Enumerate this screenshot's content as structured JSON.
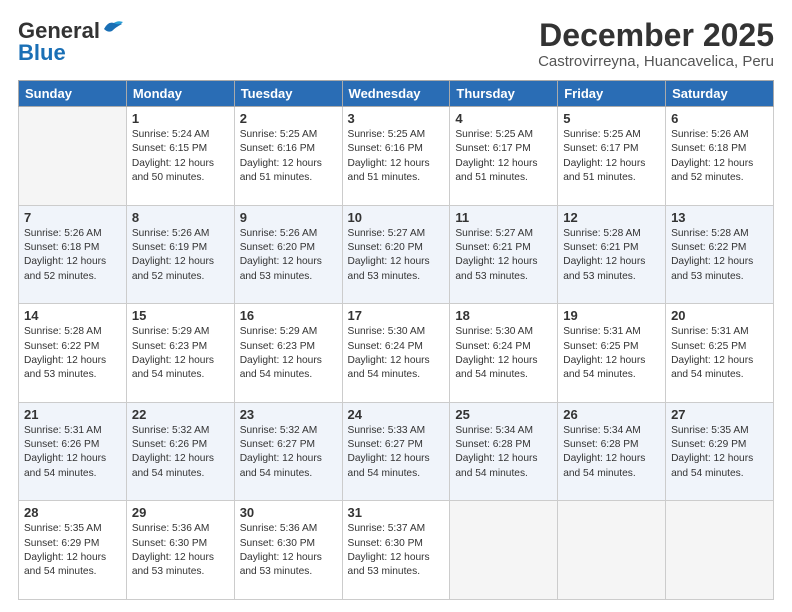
{
  "header": {
    "logo_general": "General",
    "logo_blue": "Blue",
    "month_title": "December 2025",
    "location": "Castrovirreyna, Huancavelica, Peru"
  },
  "days_header": [
    "Sunday",
    "Monday",
    "Tuesday",
    "Wednesday",
    "Thursday",
    "Friday",
    "Saturday"
  ],
  "weeks": [
    [
      {
        "day": "",
        "text": ""
      },
      {
        "day": "1",
        "text": "Sunrise: 5:24 AM\nSunset: 6:15 PM\nDaylight: 12 hours\nand 50 minutes."
      },
      {
        "day": "2",
        "text": "Sunrise: 5:25 AM\nSunset: 6:16 PM\nDaylight: 12 hours\nand 51 minutes."
      },
      {
        "day": "3",
        "text": "Sunrise: 5:25 AM\nSunset: 6:16 PM\nDaylight: 12 hours\nand 51 minutes."
      },
      {
        "day": "4",
        "text": "Sunrise: 5:25 AM\nSunset: 6:17 PM\nDaylight: 12 hours\nand 51 minutes."
      },
      {
        "day": "5",
        "text": "Sunrise: 5:25 AM\nSunset: 6:17 PM\nDaylight: 12 hours\nand 51 minutes."
      },
      {
        "day": "6",
        "text": "Sunrise: 5:26 AM\nSunset: 6:18 PM\nDaylight: 12 hours\nand 52 minutes."
      }
    ],
    [
      {
        "day": "7",
        "text": "Sunrise: 5:26 AM\nSunset: 6:18 PM\nDaylight: 12 hours\nand 52 minutes."
      },
      {
        "day": "8",
        "text": "Sunrise: 5:26 AM\nSunset: 6:19 PM\nDaylight: 12 hours\nand 52 minutes."
      },
      {
        "day": "9",
        "text": "Sunrise: 5:26 AM\nSunset: 6:20 PM\nDaylight: 12 hours\nand 53 minutes."
      },
      {
        "day": "10",
        "text": "Sunrise: 5:27 AM\nSunset: 6:20 PM\nDaylight: 12 hours\nand 53 minutes."
      },
      {
        "day": "11",
        "text": "Sunrise: 5:27 AM\nSunset: 6:21 PM\nDaylight: 12 hours\nand 53 minutes."
      },
      {
        "day": "12",
        "text": "Sunrise: 5:28 AM\nSunset: 6:21 PM\nDaylight: 12 hours\nand 53 minutes."
      },
      {
        "day": "13",
        "text": "Sunrise: 5:28 AM\nSunset: 6:22 PM\nDaylight: 12 hours\nand 53 minutes."
      }
    ],
    [
      {
        "day": "14",
        "text": "Sunrise: 5:28 AM\nSunset: 6:22 PM\nDaylight: 12 hours\nand 53 minutes."
      },
      {
        "day": "15",
        "text": "Sunrise: 5:29 AM\nSunset: 6:23 PM\nDaylight: 12 hours\nand 54 minutes."
      },
      {
        "day": "16",
        "text": "Sunrise: 5:29 AM\nSunset: 6:23 PM\nDaylight: 12 hours\nand 54 minutes."
      },
      {
        "day": "17",
        "text": "Sunrise: 5:30 AM\nSunset: 6:24 PM\nDaylight: 12 hours\nand 54 minutes."
      },
      {
        "day": "18",
        "text": "Sunrise: 5:30 AM\nSunset: 6:24 PM\nDaylight: 12 hours\nand 54 minutes."
      },
      {
        "day": "19",
        "text": "Sunrise: 5:31 AM\nSunset: 6:25 PM\nDaylight: 12 hours\nand 54 minutes."
      },
      {
        "day": "20",
        "text": "Sunrise: 5:31 AM\nSunset: 6:25 PM\nDaylight: 12 hours\nand 54 minutes."
      }
    ],
    [
      {
        "day": "21",
        "text": "Sunrise: 5:31 AM\nSunset: 6:26 PM\nDaylight: 12 hours\nand 54 minutes."
      },
      {
        "day": "22",
        "text": "Sunrise: 5:32 AM\nSunset: 6:26 PM\nDaylight: 12 hours\nand 54 minutes."
      },
      {
        "day": "23",
        "text": "Sunrise: 5:32 AM\nSunset: 6:27 PM\nDaylight: 12 hours\nand 54 minutes."
      },
      {
        "day": "24",
        "text": "Sunrise: 5:33 AM\nSunset: 6:27 PM\nDaylight: 12 hours\nand 54 minutes."
      },
      {
        "day": "25",
        "text": "Sunrise: 5:34 AM\nSunset: 6:28 PM\nDaylight: 12 hours\nand 54 minutes."
      },
      {
        "day": "26",
        "text": "Sunrise: 5:34 AM\nSunset: 6:28 PM\nDaylight: 12 hours\nand 54 minutes."
      },
      {
        "day": "27",
        "text": "Sunrise: 5:35 AM\nSunset: 6:29 PM\nDaylight: 12 hours\nand 54 minutes."
      }
    ],
    [
      {
        "day": "28",
        "text": "Sunrise: 5:35 AM\nSunset: 6:29 PM\nDaylight: 12 hours\nand 54 minutes."
      },
      {
        "day": "29",
        "text": "Sunrise: 5:36 AM\nSunset: 6:30 PM\nDaylight: 12 hours\nand 53 minutes."
      },
      {
        "day": "30",
        "text": "Sunrise: 5:36 AM\nSunset: 6:30 PM\nDaylight: 12 hours\nand 53 minutes."
      },
      {
        "day": "31",
        "text": "Sunrise: 5:37 AM\nSunset: 6:30 PM\nDaylight: 12 hours\nand 53 minutes."
      },
      {
        "day": "",
        "text": ""
      },
      {
        "day": "",
        "text": ""
      },
      {
        "day": "",
        "text": ""
      }
    ]
  ]
}
